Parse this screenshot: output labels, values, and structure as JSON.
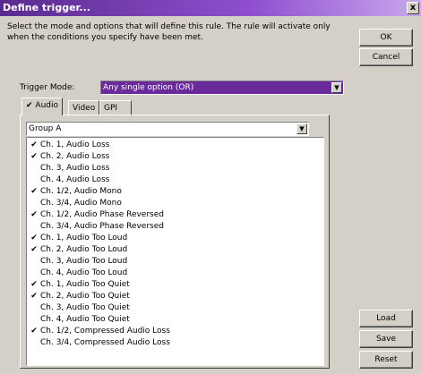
{
  "window": {
    "title": "Define trigger...",
    "close_label": "x"
  },
  "description": "Select the mode and options that will define this rule.  The rule will activate only when the conditions you specify have been met.",
  "buttons": {
    "ok": "OK",
    "cancel": "Cancel",
    "load": "Load",
    "save": "Save",
    "reset": "Reset"
  },
  "trigger_mode": {
    "label": "Trigger Mode:",
    "value": "Any single option (OR)"
  },
  "tabs": [
    {
      "label": "Audio",
      "active": true
    },
    {
      "label": "Video",
      "active": false
    },
    {
      "label": "GPI",
      "active": false
    }
  ],
  "group_select": {
    "value": "Group A"
  },
  "conditions": [
    {
      "label": "Ch. 1, Audio Loss",
      "checked": true
    },
    {
      "label": "Ch. 2, Audio Loss",
      "checked": true
    },
    {
      "label": "Ch. 3, Audio Loss",
      "checked": false
    },
    {
      "label": "Ch. 4, Audio Loss",
      "checked": false
    },
    {
      "label": "Ch. 1/2, Audio Mono",
      "checked": true
    },
    {
      "label": "Ch. 3/4, Audio Mono",
      "checked": false
    },
    {
      "label": "Ch. 1/2, Audio Phase Reversed",
      "checked": true
    },
    {
      "label": "Ch. 3/4, Audio Phase Reversed",
      "checked": false
    },
    {
      "label": "Ch. 1, Audio Too Loud",
      "checked": true
    },
    {
      "label": "Ch. 2, Audio Too Loud",
      "checked": true
    },
    {
      "label": "Ch. 3, Audio Too Loud",
      "checked": false
    },
    {
      "label": "Ch. 4, Audio Too Loud",
      "checked": false
    },
    {
      "label": "Ch. 1, Audio Too Quiet",
      "checked": true
    },
    {
      "label": "Ch. 2, Audio Too Quiet",
      "checked": true
    },
    {
      "label": "Ch. 3, Audio Too Quiet",
      "checked": false
    },
    {
      "label": "Ch. 4, Audio Too Quiet",
      "checked": false
    },
    {
      "label": "Ch. 1/2, Compressed Audio Loss",
      "checked": true
    },
    {
      "label": "Ch. 3/4, Compressed Audio Loss",
      "checked": false
    }
  ]
}
